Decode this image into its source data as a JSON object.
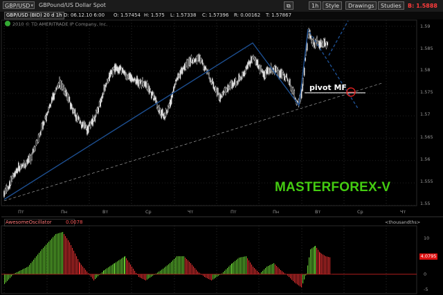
{
  "toolbar": {
    "symbol": "GBP/USD",
    "description": "GBPound/US Dollar Spot",
    "interval": "1h",
    "style": "Style",
    "drawings": "Drawings",
    "studies": "Studies",
    "price": "B: 1.5888"
  },
  "info_bar": {
    "symbol_interval": "GBP/USD (BID) 20 d 1h",
    "date": "D: 06.12.10 6:00",
    "open": "O: 1.57454",
    "high": "H: 1.575",
    "low": "L: 1.57338",
    "close": "C: 1.57396",
    "range": "R: 0.00162",
    "bid": "T: 1.57867"
  },
  "copyright": "2010 © TD AMERITRADE IP Company, Inc.",
  "annotations": {
    "brand": "MASTERFOREX-V",
    "pivot": "pivot MF"
  },
  "price_axis": [
    "1.59",
    "1.585",
    "1.58",
    "1.575",
    "1.57",
    "1.565",
    "1.56",
    "1.555",
    "1.55"
  ],
  "time_axis": [
    "Пт",
    "Пн",
    "Вт",
    "Ср",
    "Чт",
    "Пт",
    "Пн",
    "Вт",
    "Ср",
    "Чт"
  ],
  "indicator": {
    "name": "AwesomeOscillator",
    "value": "0.0078",
    "units": "<thousandths>",
    "axis": [
      "10",
      "5",
      "0",
      "-5"
    ],
    "last_value": "4.0795"
  },
  "colors": {
    "candle": "#e8e8e8",
    "trendline": "#1d4f91",
    "brand": "#44cc11",
    "ao_up": "#66cc33",
    "ao_down": "#e03030",
    "accent_red": "#ff3b3b"
  },
  "icons": {
    "symbol_caret": "▾",
    "close": "×"
  }
}
